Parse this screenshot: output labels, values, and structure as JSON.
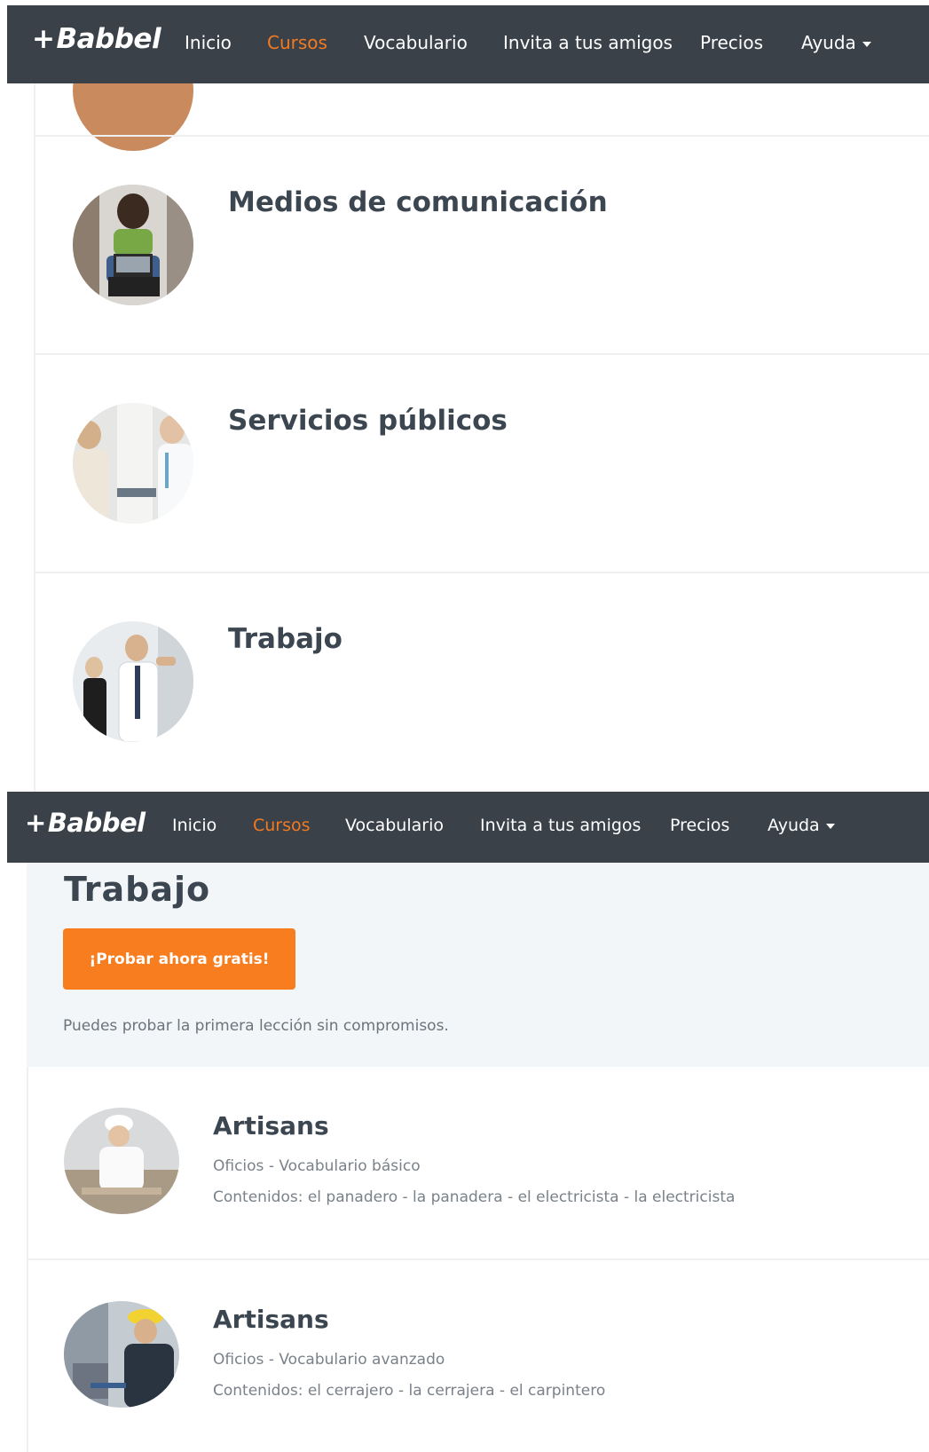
{
  "nav": {
    "logo": "Babbel",
    "logo_mark": "+",
    "items": [
      "Inicio",
      "Cursos",
      "Vocabulario",
      "Invita a tus amigos",
      "Precios",
      "Ayuda"
    ],
    "active": "Cursos",
    "active_color": "#f47a20",
    "background": "#3a4149"
  },
  "topics": [
    {
      "title": "Medios de comunicación",
      "icon": "woman-laptop-photo"
    },
    {
      "title": "Servicios públicos",
      "icon": "doctor-patient-photo"
    },
    {
      "title": "Trabajo",
      "icon": "office-workers-photo"
    }
  ],
  "course_page": {
    "title": "Trabajo",
    "cta_label": "¡Probar ahora gratis!",
    "cta_color": "#f87d1e",
    "note": "Puedes probar la primera lección sin compromisos.",
    "courses": [
      {
        "title": "Artisans",
        "subtitle": "Oficios - Vocabulario básico",
        "contents": "Contenidos: el panadero - la panadera - el electricista - la electricista",
        "icon": "baker-photo"
      },
      {
        "title": "Artisans",
        "subtitle": "Oficios - Vocabulario avanzado",
        "contents": "Contenidos: el cerrajero - la cerrajera - el carpintero",
        "icon": "craftsman-photo"
      }
    ]
  }
}
